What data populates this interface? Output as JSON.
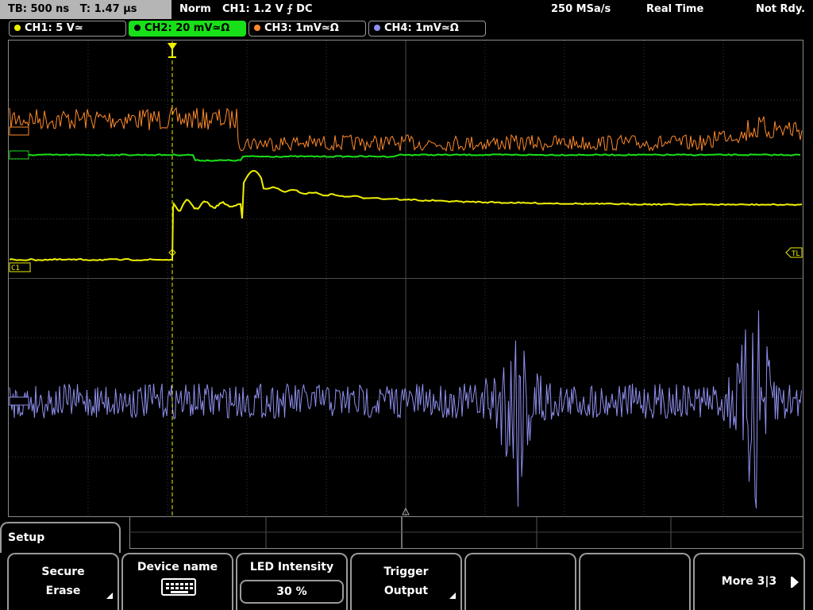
{
  "status": {
    "timebase": "TB: 500 ns",
    "trigger_time": "T: 1.47 µs",
    "mode": "Norm",
    "trigger_setting": "CH1: 1.2 V ⨍ DC",
    "sample_rate": "250 MSa/s",
    "acq_mode": "Real Time",
    "ready_state": "Not Rdy."
  },
  "channels": [
    {
      "label": "CH1: 5 V≃",
      "color": "#f0f000",
      "active": false
    },
    {
      "label": "CH2: 20 mV≃Ω",
      "color": "#18e018",
      "active": true
    },
    {
      "label": "CH3: 1mV≃Ω",
      "color": "#ff8a2a",
      "active": false
    },
    {
      "label": "CH4: 1mV≃Ω",
      "color": "#8f8fef",
      "active": false
    }
  ],
  "markers": {
    "ch1": "C1",
    "trigger_level": "TL"
  },
  "menu": {
    "title": "Setup",
    "softkeys": [
      {
        "line1": "Secure",
        "line2": "Erase"
      },
      {
        "line1": "Device name",
        "icon": "keyboard-icon"
      },
      {
        "line1": "LED Intensity",
        "value": "30 %"
      },
      {
        "line1": "Trigger",
        "line2": "Output"
      },
      {
        "line1": ""
      },
      {
        "line1": ""
      },
      {
        "line1": "More 3|3"
      }
    ]
  }
}
